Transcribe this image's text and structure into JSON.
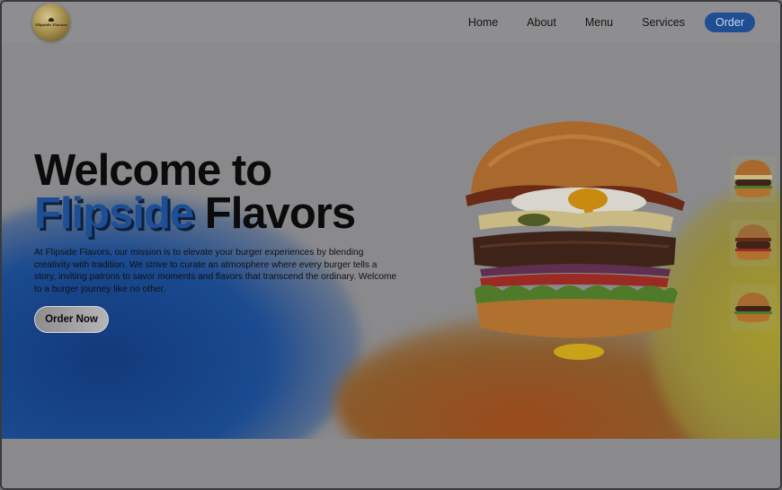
{
  "logo": {
    "text": "Flipside Flavors"
  },
  "nav": {
    "items": [
      "Home",
      "About",
      "Menu",
      "Services"
    ],
    "order_label": "Order"
  },
  "hero": {
    "headline_line1": "Welcome to",
    "headline_accent": "Flipside",
    "headline_rest": "Flavors",
    "description": "At Flipside Flavors, our mission is to elevate your burger experiences by blending creativity with tradition. We strive to curate an atmosphere where every burger tells a story, inviting patrons to savor moments and flavors that transcend the ordinary. Welcome to a burger journey like no other.",
    "cta_label": "Order Now"
  },
  "colors": {
    "accent": "#1e4f95",
    "order_button": "#1f4f92",
    "background": "#8a8a8c"
  },
  "icons": {
    "logo": "flipside-flavors-logo",
    "main_image": "burger-image",
    "thumbnails": [
      "burger-thumbnail-1",
      "burger-thumbnail-2",
      "burger-thumbnail-3"
    ]
  }
}
